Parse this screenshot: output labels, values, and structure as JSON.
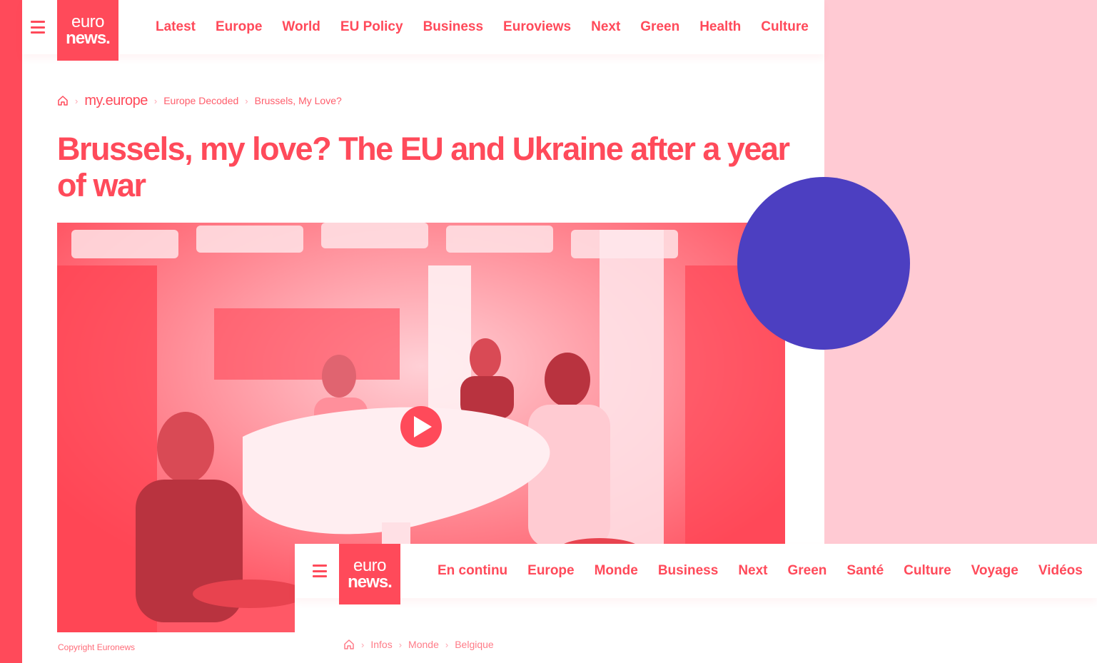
{
  "top": {
    "logo_line1": "euro",
    "logo_line2": "news.",
    "nav": [
      "Latest",
      "Europe",
      "World",
      "EU Policy",
      "Business",
      "Euroviews",
      "Next",
      "Green",
      "Health",
      "Culture"
    ]
  },
  "breadcrumb": {
    "brand": "my.europe",
    "items": [
      "Europe Decoded",
      "Brussels, My Love?"
    ]
  },
  "article": {
    "title": "Brussels, my love? The EU and Ukraine after a year of war",
    "copyright": "Copyright Euronews"
  },
  "bottom": {
    "logo_line1": "euro",
    "logo_line2": "news.",
    "nav": [
      "En continu",
      "Europe",
      "Monde",
      "Business",
      "Next",
      "Green",
      "Santé",
      "Culture",
      "Voyage",
      "Vidéos"
    ],
    "breadcrumb": [
      "Infos",
      "Monde",
      "Belgique"
    ]
  },
  "colors": {
    "brand": "#ff4a5a",
    "panel": "#ffcad3",
    "circle": "#4c3fc1"
  }
}
